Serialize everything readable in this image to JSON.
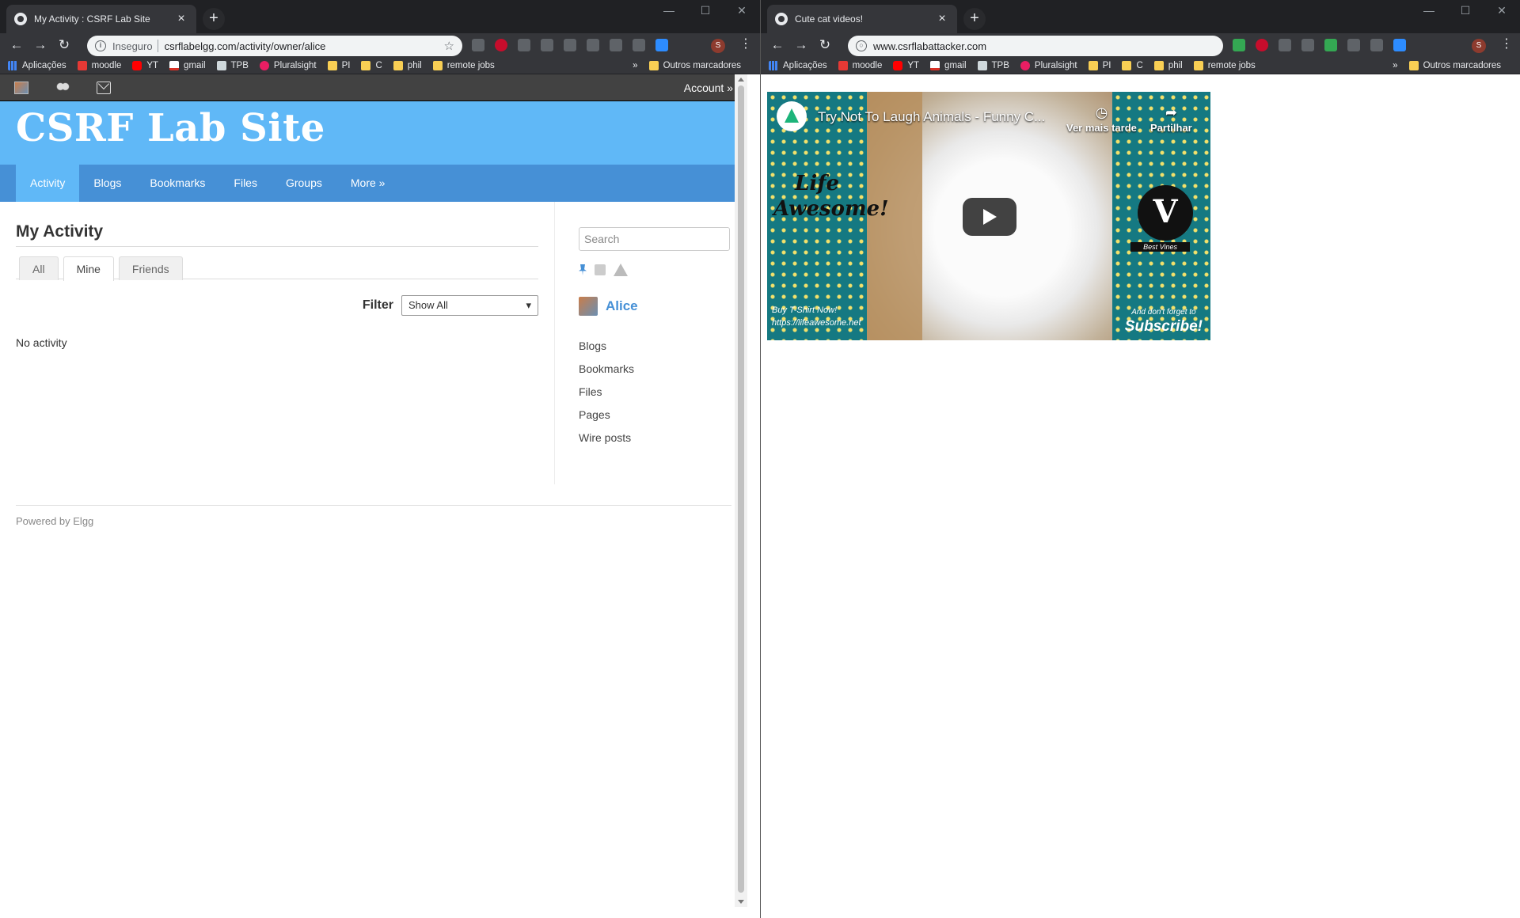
{
  "left": {
    "tab_title": "My Activity : CSRF Lab Site",
    "omnibox": {
      "security": "Inseguro",
      "url": "csrflabelgg.com/activity/owner/alice"
    },
    "bookmarks": [
      "Aplicações",
      "moodle",
      "YT",
      "gmail",
      "TPB",
      "Pluralsight",
      "PI",
      "C",
      "phil",
      "remote jobs"
    ],
    "bookmarks_more": "»",
    "bookmarks_other": "Outros marcadores",
    "avatar_letter": "S",
    "site": {
      "account": "Account »",
      "title": "CSRF Lab Site",
      "menu": [
        "Activity",
        "Blogs",
        "Bookmarks",
        "Files",
        "Groups",
        "More »"
      ],
      "page_title": "My Activity",
      "tabs": [
        "All",
        "Mine",
        "Friends"
      ],
      "selected_tab": "Mine",
      "filter_label": "Filter",
      "filter_value": "Show All",
      "empty_text": "No activity",
      "search_placeholder": "Search",
      "owner_name": "Alice",
      "owner_menu": [
        "Blogs",
        "Bookmarks",
        "Files",
        "Pages",
        "Wire posts"
      ],
      "footer": "Powered by Elgg"
    }
  },
  "right": {
    "tab_title": "Cute cat videos!",
    "omnibox": {
      "url": "www.csrflabattacker.com"
    },
    "bookmarks": [
      "Aplicações",
      "moodle",
      "YT",
      "gmail",
      "TPB",
      "Pluralsight",
      "PI",
      "C",
      "phil",
      "remote jobs"
    ],
    "bookmarks_more": "»",
    "bookmarks_other": "Outros marcadores",
    "avatar_letter": "S",
    "video": {
      "title": "Try Not To Laugh Animals - Funny C...",
      "watch_later": "Ver mais tarde",
      "share": "Partilhar",
      "life_text": "Life Awesome!",
      "shirt_line1": "Buy T-Shirt Now!",
      "shirt_line2": "https://lifeawesome.net",
      "vine_text": "V",
      "best_vines": "Best Vines",
      "sub_line1": "And don't forget to",
      "sub_line2": "Subscribe!"
    }
  },
  "colors": {
    "elgg_header": "#60b8f7",
    "elgg_menu": "#4690d6",
    "chrome_dark": "#35363a"
  }
}
